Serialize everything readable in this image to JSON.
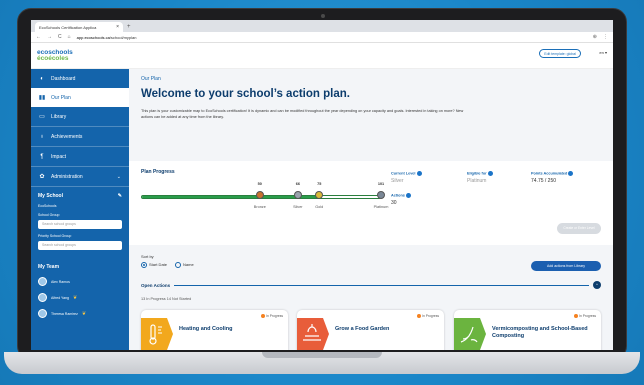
{
  "colors": {
    "background": "#1a86c8",
    "sidebar": "#1464ab",
    "title": "#0d3d6d",
    "progress_green": "#2a9d4b",
    "status_dot": "#f58220"
  },
  "browser": {
    "tab_title": "EcoSchools Certification Applica",
    "tab_close": "×",
    "new_tab": "+",
    "url_prefix": "app.ecoschools.ca",
    "url_path": "/school/myplan",
    "nav_back": "←",
    "nav_forward": "→",
    "nav_reload": "C",
    "nav_home": "⌂",
    "menu_icon": "⋮",
    "ext_icon": "⊕"
  },
  "header": {
    "logo_line1": "ecoschools",
    "logo_line2": "écoécoles",
    "edit_template": "Edit template: global",
    "language": "en ▾"
  },
  "sidebar": {
    "items": [
      {
        "label": "Dashboard",
        "icon": "dashboard-icon"
      },
      {
        "label": "Our Plan",
        "icon": "plan-icon"
      },
      {
        "label": "Library",
        "icon": "book-icon"
      },
      {
        "label": "Achievements",
        "icon": "medal-icon"
      },
      {
        "label": "Impact",
        "icon": "thermometer-icon"
      },
      {
        "label": "Administration",
        "icon": "gear-icon"
      }
    ],
    "my_school": "My School",
    "ecoschools": "EcoSchools",
    "school_group": "School Group",
    "search_school_groups": "Search school groups",
    "priority_school_group": "Priority School Group",
    "search_school_groups_2": "Search school groups",
    "my_team": "My Team",
    "members": [
      "Alex Ramos",
      "Alfred Yang",
      "Theresa Ramirez"
    ]
  },
  "main": {
    "breadcrumb": "Our Plan",
    "title": "Welcome to your school’s action plan.",
    "intro": "This plan is your customizable map to EcoSchools certification! It is dynamic and can be modified throughout the year depending on your capacity and goals. Interested in taking on more? New actions can be added at any time from the library.",
    "plan_progress": "Plan Progress",
    "progress_value": 74.75,
    "progress_max": 101,
    "milestones": [
      {
        "value": "50",
        "label": "Bronze"
      },
      {
        "value": "66",
        "label": "Silver"
      },
      {
        "value": "75",
        "label": "Gold"
      },
      {
        "value": "101",
        "label": "Platinum"
      }
    ],
    "current_level_label": "Current Level",
    "current_level": "Silver",
    "eligible_for_label": "Eligible for",
    "eligible_for": "Platinum",
    "points_label": "Points Accumulated",
    "points": "74.75 / 250",
    "actions_label": "Actions",
    "actions": "30",
    "disabled_button": "Create or Enter Level",
    "sort_by": "Sort by",
    "sort_start": "Start Date",
    "sort_name": "Name",
    "add_actions": "Add actions from Library",
    "open_actions": "Open Actions",
    "collapse_icon": "^",
    "counts": "13 In Progress    14 Not Started"
  },
  "cards": [
    {
      "title": "Heating and Cooling",
      "status": "In Progress",
      "icon": "thermometer-card-icon",
      "color": "#f2a81d"
    },
    {
      "title": "Grow a Food Garden",
      "status": "In Progress",
      "icon": "garden-card-icon",
      "color": "#e85d3a"
    },
    {
      "title": "Vermicomposting and School-Based Composting",
      "status": "In Progress",
      "icon": "compost-card-icon",
      "color": "#6bb43f"
    }
  ]
}
